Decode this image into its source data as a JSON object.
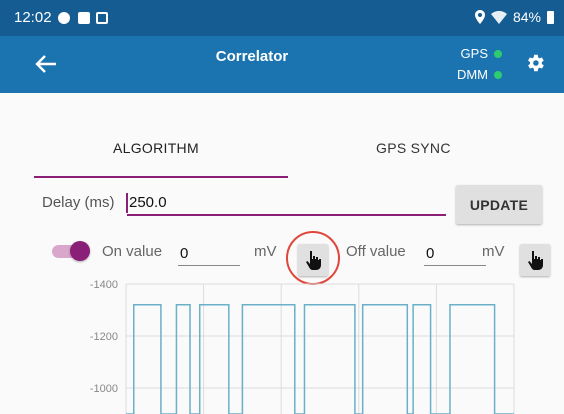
{
  "status_bar": {
    "time": "12:02",
    "battery": "84%",
    "icons": [
      "notification-icon",
      "checkbox-icon",
      "image-icon",
      "location-icon",
      "wifi-icon",
      "battery-icon"
    ]
  },
  "app_bar": {
    "title": "Correlator",
    "gps_label": "GPS",
    "dmm_label": "DMM",
    "gps_status_color": "#2ecc71",
    "dmm_status_color": "#2ecc71",
    "background": "#1b74b0"
  },
  "tabs": [
    {
      "label": "ALGORITHM",
      "selected": true
    },
    {
      "label": "GPS SYNC",
      "selected": false
    }
  ],
  "delay": {
    "label": "Delay (ms)",
    "value": "250.0",
    "update_label": "UPDATE"
  },
  "on_off": {
    "toggle_on": true,
    "on_label": "On value",
    "on_value": "0",
    "on_unit": "mV",
    "off_label": "Off value",
    "off_value": "0",
    "off_unit": "mV"
  },
  "accent_color": "#8a1f78",
  "chart_data": {
    "type": "line",
    "y_ticks": [
      "-1400",
      "-1200",
      "-1000"
    ],
    "ylim": [
      -1400,
      -900
    ],
    "reversed_y": true,
    "grid": true,
    "series": [
      {
        "color": "#6ab0c8",
        "points": [
          [
            0.0,
            -900
          ],
          [
            0.02,
            -900
          ],
          [
            0.02,
            -1320
          ],
          [
            0.09,
            -1320
          ],
          [
            0.09,
            -900
          ],
          [
            0.13,
            -900
          ],
          [
            0.13,
            -1320
          ],
          [
            0.165,
            -1320
          ],
          [
            0.165,
            -900
          ],
          [
            0.19,
            -900
          ],
          [
            0.19,
            -1320
          ],
          [
            0.265,
            -1320
          ],
          [
            0.265,
            -900
          ],
          [
            0.3,
            -900
          ],
          [
            0.3,
            -1320
          ],
          [
            0.435,
            -1320
          ],
          [
            0.435,
            -900
          ],
          [
            0.46,
            -900
          ],
          [
            0.46,
            -1320
          ],
          [
            0.59,
            -1320
          ],
          [
            0.59,
            -900
          ],
          [
            0.61,
            -900
          ],
          [
            0.61,
            -1320
          ],
          [
            0.725,
            -1320
          ],
          [
            0.725,
            -900
          ],
          [
            0.74,
            -900
          ],
          [
            0.74,
            -1320
          ],
          [
            0.785,
            -1320
          ],
          [
            0.785,
            -900
          ],
          [
            0.835,
            -900
          ],
          [
            0.835,
            -1320
          ],
          [
            0.95,
            -1320
          ],
          [
            0.95,
            -900
          ],
          [
            1.0,
            -900
          ]
        ]
      }
    ]
  }
}
